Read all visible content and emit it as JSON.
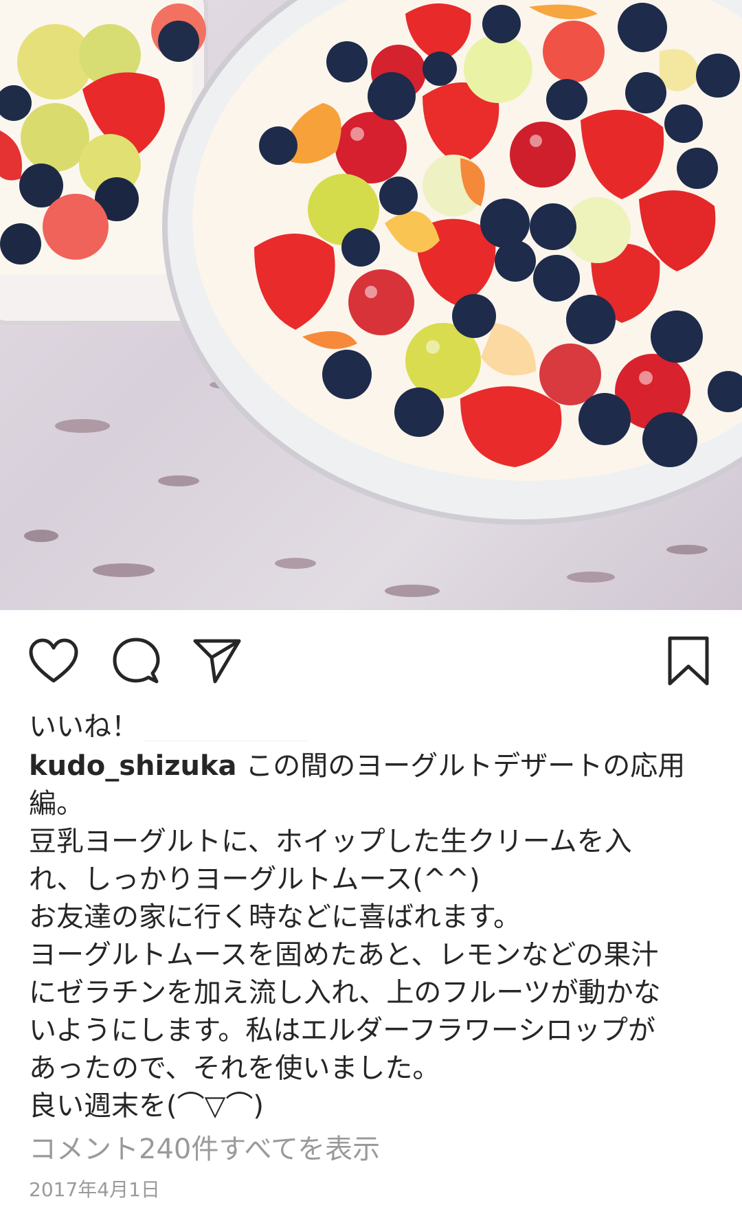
{
  "post": {
    "photo_alt": "glass bowls of yogurt mousse topped with strawberries, blueberries, grapes and citrus",
    "actions": {
      "like_icon": "heart-icon",
      "comment_icon": "comment-icon",
      "share_icon": "send-icon",
      "save_icon": "bookmark-icon"
    },
    "likes_label": "いいね！",
    "username": "kudo_shizuka",
    "caption_lines": [
      "この間のヨーグルトデザートの応用",
      "編。",
      "豆乳ヨーグルトに、ホイップした生クリームを入",
      "れ、しっかりヨーグルトムース(^^)",
      "お友達の家に行く時などに喜ばれます。",
      "ヨーグルトムースを固めたあと、レモンなどの果汁",
      "にゼラチンを加え流し入れ、上のフルーツが動かな",
      "いようにします。私はエルダーフラワーシロップが",
      "あったので、それを使いました。",
      "良い週末を(⌒▽⌒)"
    ],
    "comments_link": "コメント240件すべてを表示",
    "date": "2017年4月1日"
  }
}
